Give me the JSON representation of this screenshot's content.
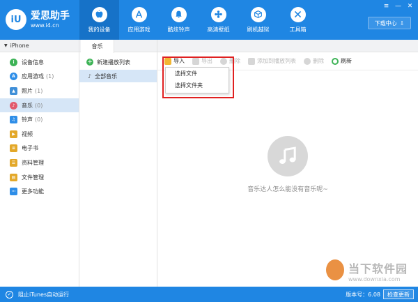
{
  "app": {
    "name": "爱思助手",
    "url": "www.i4.cn",
    "logo_mark": "iU"
  },
  "nav": [
    {
      "label": "我的设备",
      "icon": "apple-icon",
      "active": true
    },
    {
      "label": "应用游戏",
      "icon": "app-store-icon"
    },
    {
      "label": "酷炫铃声",
      "icon": "bell-icon"
    },
    {
      "label": "高清壁纸",
      "icon": "flower-icon"
    },
    {
      "label": "刷机越狱",
      "icon": "box-icon"
    },
    {
      "label": "工具箱",
      "icon": "tools-icon"
    }
  ],
  "window_controls": {
    "menu": "≡",
    "minimize": "—",
    "close": "✕"
  },
  "download_center": {
    "label": "下载中心",
    "icon": "download-icon"
  },
  "device": {
    "name": "iPhone",
    "expand": "▼"
  },
  "sidebar": {
    "items": [
      {
        "label": "设备信息",
        "count": "",
        "icon": "info-icon",
        "color": "#3db356"
      },
      {
        "label": "应用游戏",
        "count": "(1)",
        "icon": "apps-icon",
        "color": "#2e8ee8"
      },
      {
        "label": "照片",
        "count": "(1)",
        "icon": "photo-icon",
        "color": "#3f8fd8"
      },
      {
        "label": "音乐",
        "count": "(0)",
        "icon": "music-icon",
        "color": "#e25a6c",
        "active": true
      },
      {
        "label": "铃声",
        "count": "(0)",
        "icon": "ringtone-icon",
        "color": "#2e8ee8"
      },
      {
        "label": "视频",
        "count": "",
        "icon": "video-icon",
        "color": "#e3a829"
      },
      {
        "label": "电子书",
        "count": "",
        "icon": "book-icon",
        "color": "#e3a829"
      },
      {
        "label": "资料管理",
        "count": "",
        "icon": "contacts-icon",
        "color": "#e3a829"
      },
      {
        "label": "文件管理",
        "count": "",
        "icon": "file-icon",
        "color": "#e3a829"
      },
      {
        "label": "更多功能",
        "count": "",
        "icon": "more-icon",
        "color": "#2e8ee8"
      }
    ]
  },
  "panel": {
    "tab": "音乐",
    "new_playlist": "新建播放列表",
    "playlists": [
      {
        "label": "全部音乐"
      }
    ]
  },
  "toolbar": {
    "import": "导入",
    "export": "导出",
    "delete_dup": "删除",
    "add_to_playlist": "添加到播放列表",
    "delete": "删除",
    "refresh": "刷新"
  },
  "import_menu": {
    "select_file": "选择文件",
    "select_folder": "选择文件夹"
  },
  "empty_state": {
    "message": "音乐达人怎么能没有音乐呢~"
  },
  "bottom": {
    "itunes_label": "阻止iTunes自动运行",
    "version": "版本号：6.08",
    "update": "检查更新"
  },
  "watermark": {
    "text": "当下软件园",
    "url": "www.downxia.com"
  },
  "colors": {
    "brand": "#1f86e3",
    "highlight": "#e02020",
    "active_row": "#d6e6f7"
  }
}
